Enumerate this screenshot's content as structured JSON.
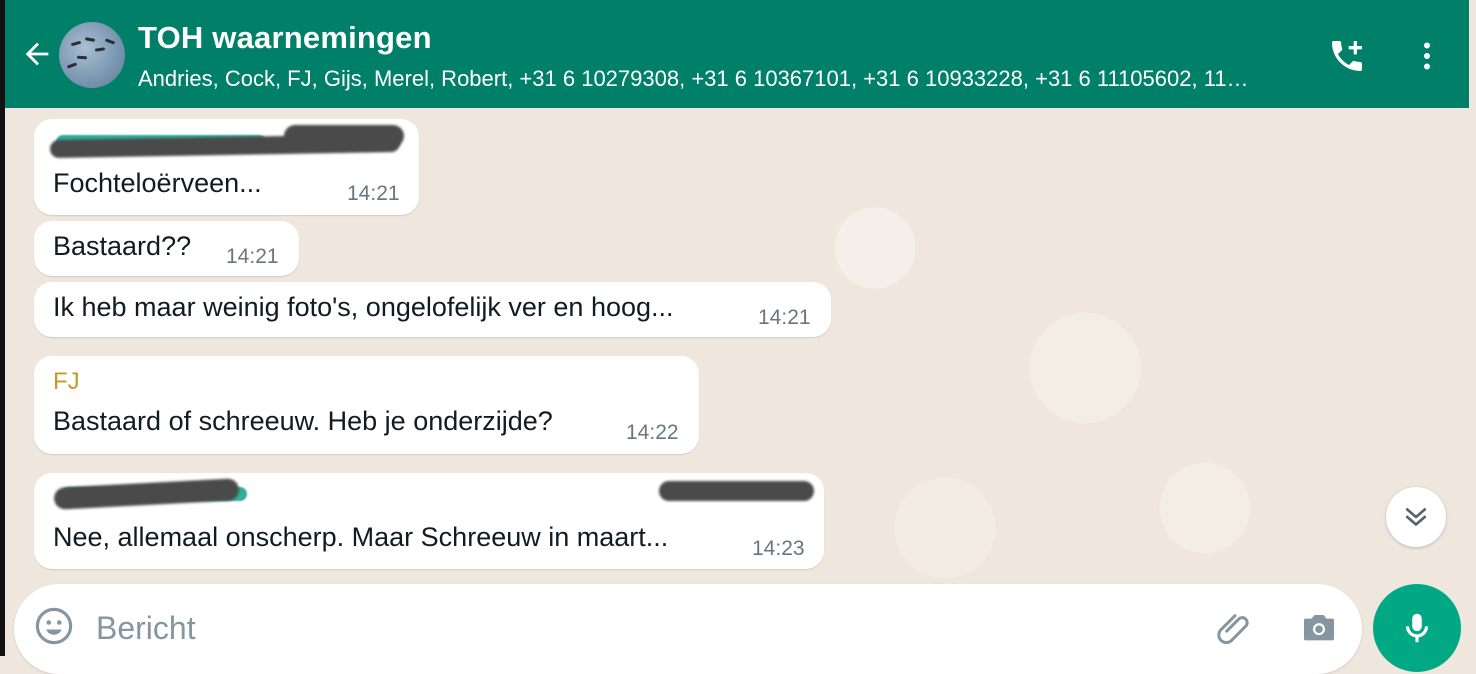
{
  "header": {
    "title": "TOH waarnemingen",
    "subtitle": "Andries, Cock, FJ, Gijs, Merel, Robert, +31 6 10279308, +31 6 10367101, +31 6 10933228, +31 6 11105602, 11…",
    "back_icon": "arrow-left-icon",
    "call_icon": "add-call-icon",
    "menu_icon": "more-vertical-icon",
    "color": "#008069"
  },
  "messages": [
    {
      "sender": "",
      "sender_redacted": true,
      "text": "Fochteloërveen...",
      "time": "14:21"
    },
    {
      "sender": "",
      "text": "Bastaard??",
      "time": "14:21"
    },
    {
      "sender": "",
      "text": "Ik heb maar weinig foto's, ongelofelijk ver en hoog...",
      "time": "14:21"
    },
    {
      "sender": "FJ",
      "text": "Bastaard of schreeuw. Heb je onderzijde?",
      "time": "14:22"
    },
    {
      "sender": "",
      "sender_redacted": true,
      "text": "Nee, allemaal onscherp. Maar Schreeuw in maart...",
      "time": "14:23"
    }
  ],
  "composer": {
    "placeholder": "Bericht",
    "value": "",
    "emoji_icon": "emoji-icon",
    "attach_icon": "paperclip-icon",
    "camera_icon": "camera-icon",
    "mic_icon": "microphone-icon",
    "accent": "#00a884"
  }
}
